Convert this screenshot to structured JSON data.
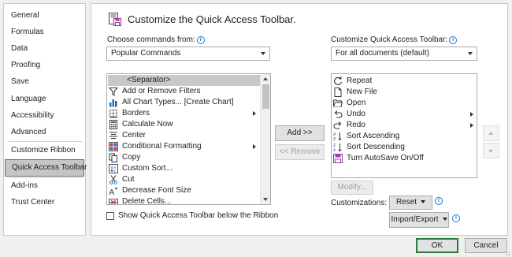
{
  "nav": {
    "items": [
      "General",
      "Formulas",
      "Data",
      "Proofing",
      "Save",
      "Language",
      "Accessibility",
      "Advanced",
      "Customize Ribbon",
      "Quick Access Toolbar",
      "Add-ins",
      "Trust Center"
    ],
    "selected": "Quick Access Toolbar"
  },
  "header": {
    "title": "Customize the Quick Access Toolbar."
  },
  "choose": {
    "label": "Choose commands from:",
    "value": "Popular Commands",
    "info_icon": "info-icon"
  },
  "customize_qat": {
    "label": "Customize Quick Access Toolbar:",
    "value": "For all documents (default)",
    "info_icon": "info-icon"
  },
  "commands": [
    {
      "label": "<Separator>",
      "icon": "none",
      "selected": true
    },
    {
      "label": "Add or Remove Filters",
      "icon": "funnel-icon"
    },
    {
      "label": "All Chart Types... [Create Chart]",
      "icon": "bar-chart-icon"
    },
    {
      "label": "Borders",
      "icon": "borders-icon",
      "submenu": true
    },
    {
      "label": "Calculate Now",
      "icon": "calculator-icon"
    },
    {
      "label": "Center",
      "icon": "align-center-icon"
    },
    {
      "label": "Conditional Formatting",
      "icon": "conditional-formatting-icon",
      "submenu": true
    },
    {
      "label": "Copy",
      "icon": "copy-icon"
    },
    {
      "label": "Custom Sort...",
      "icon": "custom-sort-icon"
    },
    {
      "label": "Cut",
      "icon": "scissors-icon"
    },
    {
      "label": "Decrease Font Size",
      "icon": "decrease-font-icon"
    },
    {
      "label": "Delete Cells...",
      "icon": "delete-cells-icon"
    }
  ],
  "toolbar_items": [
    {
      "label": "Repeat",
      "icon": "repeat-icon"
    },
    {
      "label": "New File",
      "icon": "new-file-icon"
    },
    {
      "label": "Open",
      "icon": "open-folder-icon"
    },
    {
      "label": "Undo",
      "icon": "undo-icon",
      "submenu": true
    },
    {
      "label": "Redo",
      "icon": "redo-icon",
      "submenu": true
    },
    {
      "label": "Sort Ascending",
      "icon": "sort-ascending-icon"
    },
    {
      "label": "Sort Descending",
      "icon": "sort-descending-icon"
    },
    {
      "label": "Turn AutoSave On/Off",
      "icon": "autosave-icon"
    }
  ],
  "buttons": {
    "add": "Add >>",
    "remove": "<< Remove",
    "modify": "Modify...",
    "reset": "Reset",
    "import_export": "Import/Export",
    "ok": "OK",
    "cancel": "Cancel"
  },
  "customizations_label": "Customizations:",
  "show_below_ribbon": {
    "label": "Show Quick Access Toolbar below the Ribbon",
    "checked": false
  },
  "colors": {
    "accent_blue": "#1a6fd4",
    "default_button_border": "#2b7a3e",
    "autosave_purple": "#a33ba6"
  }
}
